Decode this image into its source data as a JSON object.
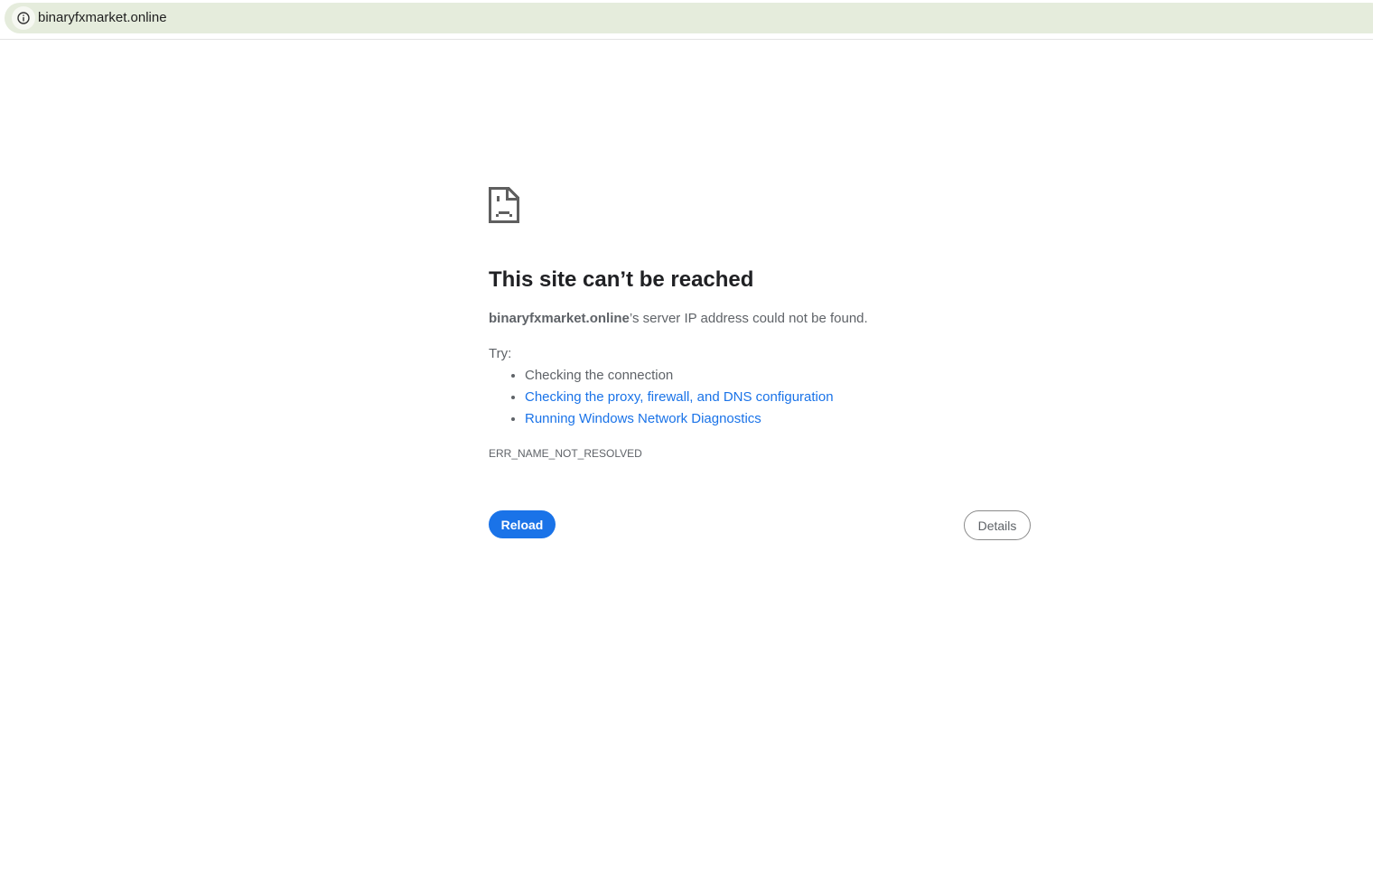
{
  "browser": {
    "url": "binaryfxmarket.online",
    "info_icon": "info-icon"
  },
  "error": {
    "icon": "sad-document-icon",
    "title": "This site can’t be reached",
    "host": "binaryfxmarket.online",
    "message_suffix": "’s server IP address could not be found.",
    "try_label": "Try:",
    "suggestions": [
      {
        "text": "Checking the connection",
        "link": false
      },
      {
        "text": "Checking the proxy, firewall, and DNS configuration",
        "link": true
      },
      {
        "text": "Running Windows Network Diagnostics",
        "link": true
      }
    ],
    "code": "ERR_NAME_NOT_RESOLVED",
    "reload_label": "Reload",
    "details_label": "Details"
  }
}
